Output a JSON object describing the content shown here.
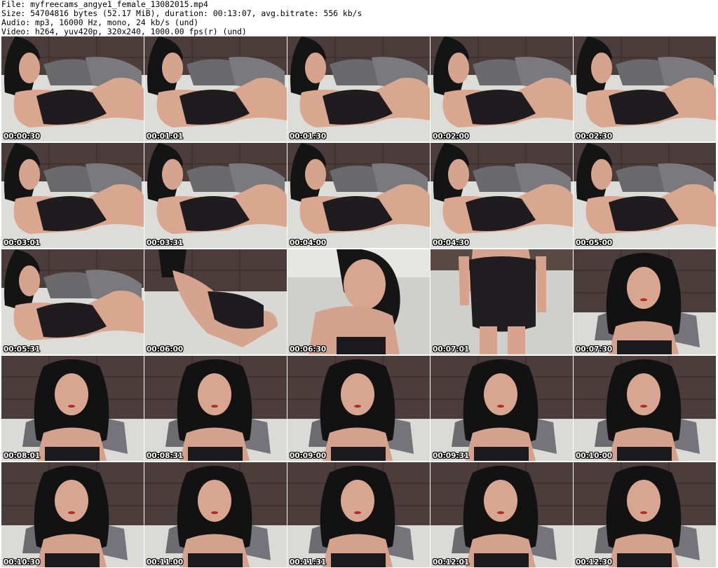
{
  "header": {
    "line1": "File: myfreecams_angye1_female_13082015.mp4",
    "line2": "Size: 54704816 bytes (52.17 MiB), duration: 00:13:07, avg.bitrate: 556 kb/s",
    "line3": "Audio: mp3, 16000 Hz, mono, 24 kb/s (und)",
    "line4": "Video: h264, yuv420p, 320x240, 1000.00 fps(r) (und)"
  },
  "thumbnails": [
    {
      "timestamp": "00:00:30",
      "scene": "lying"
    },
    {
      "timestamp": "00:01:01",
      "scene": "lying"
    },
    {
      "timestamp": "00:01:30",
      "scene": "lying"
    },
    {
      "timestamp": "00:02:00",
      "scene": "lying"
    },
    {
      "timestamp": "00:02:30",
      "scene": "lying"
    },
    {
      "timestamp": "00:03:01",
      "scene": "lying"
    },
    {
      "timestamp": "00:03:31",
      "scene": "lying"
    },
    {
      "timestamp": "00:04:00",
      "scene": "lying"
    },
    {
      "timestamp": "00:04:30",
      "scene": "lying"
    },
    {
      "timestamp": "00:05:00",
      "scene": "lying"
    },
    {
      "timestamp": "00:05:31",
      "scene": "lying"
    },
    {
      "timestamp": "00:06:00",
      "scene": "kneeling"
    },
    {
      "timestamp": "00:06:30",
      "scene": "closeup"
    },
    {
      "timestamp": "00:07:01",
      "scene": "standing"
    },
    {
      "timestamp": "00:07:30",
      "scene": "portrait"
    },
    {
      "timestamp": "00:08:01",
      "scene": "portrait"
    },
    {
      "timestamp": "00:08:31",
      "scene": "portrait"
    },
    {
      "timestamp": "00:09:00",
      "scene": "portrait"
    },
    {
      "timestamp": "00:09:31",
      "scene": "portrait"
    },
    {
      "timestamp": "00:10:00",
      "scene": "portrait"
    },
    {
      "timestamp": "00:10:30",
      "scene": "portrait"
    },
    {
      "timestamp": "00:11:00",
      "scene": "portrait"
    },
    {
      "timestamp": "00:11:31",
      "scene": "portrait"
    },
    {
      "timestamp": "00:12:01",
      "scene": "portrait"
    },
    {
      "timestamp": "00:12:30",
      "scene": "portrait"
    }
  ]
}
